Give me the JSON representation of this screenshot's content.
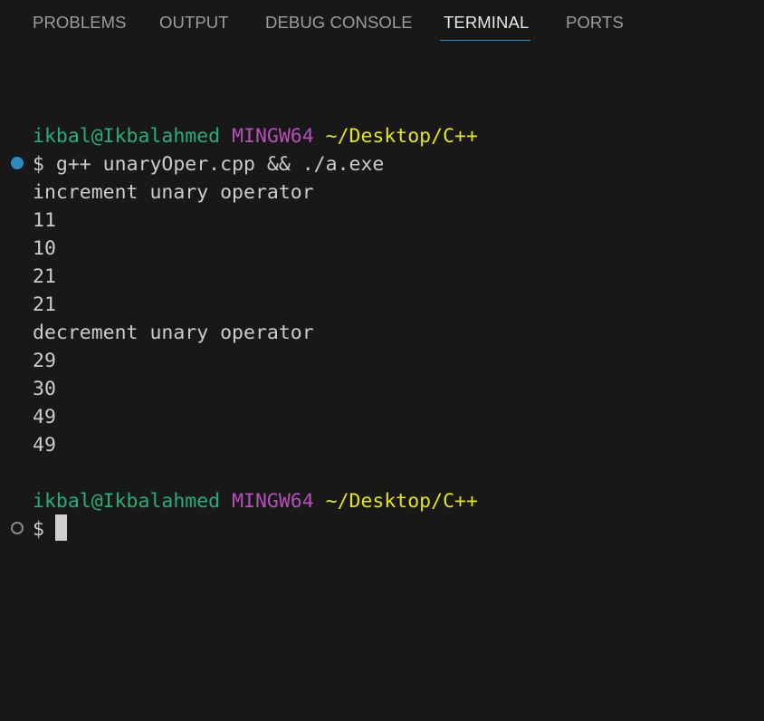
{
  "panel_tabs": [
    {
      "label": "PROBLEMS",
      "active": false
    },
    {
      "label": "OUTPUT",
      "active": false
    },
    {
      "label": "DEBUG CONSOLE",
      "active": false
    },
    {
      "label": "TERMINAL",
      "active": true
    },
    {
      "label": "PORTS",
      "active": false
    }
  ],
  "prompt": {
    "user_host": "ikbal@Ikbalahmed",
    "shell": "MINGW64",
    "cwd": "~/Desktop/C++",
    "symbol": "$"
  },
  "command": "g++ unaryOper.cpp && ./a.exe",
  "output": [
    "increment unary operator",
    "11",
    "10",
    "21",
    "21",
    "decrement unary operator",
    "29",
    "30",
    "49",
    "49"
  ],
  "colors": {
    "background": "#181818",
    "user": "#23b07a",
    "shell": "#b64fb8",
    "path": "#e5e510",
    "text": "#cccccc",
    "active_tab_underline": "#2f8fd8",
    "success_dot": "#2c8ac1"
  }
}
